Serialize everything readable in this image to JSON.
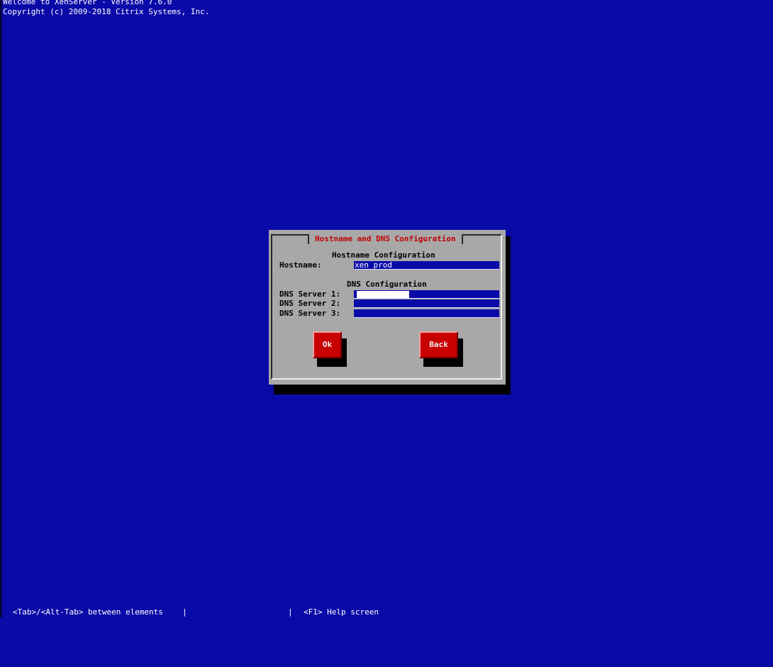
{
  "header": {
    "line1": "Welcome to XenServer - Version 7.6.0",
    "line2": "Copyright (c) 2009-2018 Citrix Systems, Inc."
  },
  "dialog": {
    "title": "Hostname and DNS Configuration",
    "hostname_section": "Hostname Configuration",
    "hostname_label": "Hostname:",
    "hostname_value": "xen_prod_",
    "dns_section": "DNS Configuration",
    "dns1_label": "DNS Server 1:",
    "dns1_value": "",
    "dns2_label": "DNS Server 2:",
    "dns2_value": "",
    "dns3_label": "DNS Server 3:",
    "dns3_value": "",
    "ok_label": "Ok",
    "back_label": "Back"
  },
  "statusbar": {
    "left": "<Tab>/<Alt-Tab> between elements",
    "separator": "|",
    "right": "<F1> Help screen"
  },
  "colors": {
    "background": "#0a0aa8",
    "dialog": "#a8a8a8",
    "title": "#c00000",
    "button": "#c80000"
  }
}
